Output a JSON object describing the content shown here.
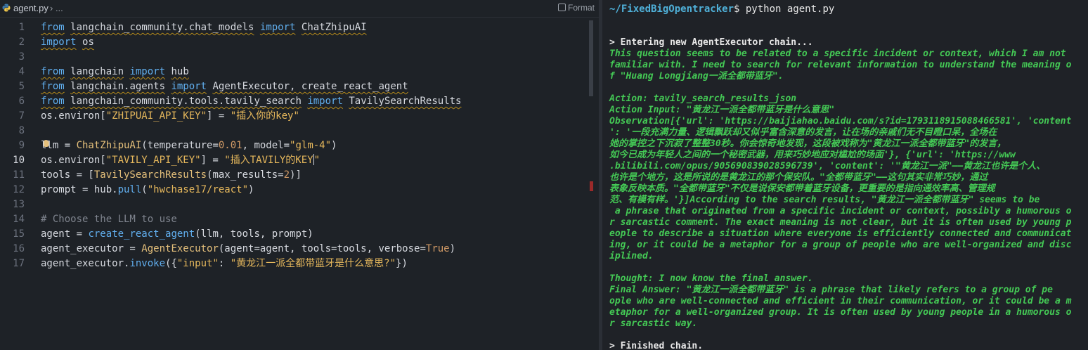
{
  "editor": {
    "tab_file": "agent.py",
    "tab_crumb": "› ...",
    "format_label": "Format",
    "line_numbers": [
      "1",
      "2",
      "3",
      "4",
      "5",
      "6",
      "7",
      "8",
      "9",
      "10",
      "11",
      "12",
      "13",
      "14",
      "15",
      "16",
      "17"
    ]
  },
  "code": {
    "l1": {
      "a": "from",
      "b": "langchain_community.chat_models",
      "c": "import",
      "d": "ChatZhipuAI"
    },
    "l2": {
      "a": "import",
      "b": "os"
    },
    "l4": {
      "a": "from",
      "b": "langchain",
      "c": "import",
      "d": "hub"
    },
    "l5": {
      "a": "from",
      "b": "langchain.agents",
      "c": "import",
      "d": "AgentExecutor, create_react_agent"
    },
    "l6": {
      "a": "from",
      "b": "langchain_community.tools.tavily_search",
      "c": "import",
      "d": "TavilySearchResults"
    },
    "l7": {
      "a": "os.environ[",
      "b": "\"ZHIPUAI_API_KEY\"",
      "c": "] = ",
      "d": "\"插入你的key\""
    },
    "l9": {
      "a": "llm = ",
      "b": "ChatZhipuAI",
      "c": "(temperature=",
      "d": "0.01",
      "e": ", model=",
      "f": "\"glm-4\"",
      "g": ")"
    },
    "l10": {
      "a": "os.environ[",
      "b": "\"TAVILY_API_KEY\"",
      "c": "] = ",
      "d": "\"插入TAVILY的KEY",
      "e": "\""
    },
    "l11": {
      "a": "tools = [",
      "b": "TavilySearchResults",
      "c": "(max_results=",
      "d": "2",
      "e": ")]"
    },
    "l12": {
      "a": "prompt = hub.",
      "b": "pull",
      "c": "(",
      "d": "\"hwchase17/react\"",
      "e": ")"
    },
    "l14": {
      "a": "# Choose the LLM to use"
    },
    "l15": {
      "a": "agent = ",
      "b": "create_react_agent",
      "c": "(llm, tools, prompt)"
    },
    "l16": {
      "a": "agent_executor = ",
      "b": "AgentExecutor",
      "c": "(agent=agent, tools=tools, verbose=",
      "d": "True",
      "e": ")"
    },
    "l17": {
      "a": "agent_executor.",
      "b": "invoke",
      "c": "({",
      "d": "\"input\"",
      "e": ": ",
      "f": "\"黄龙江一派全都带蓝牙是什么意思?\"",
      "g": "})"
    }
  },
  "terminal": {
    "prompt_path": "~/FixedBigOpentracker",
    "prompt_cmd": "$ python agent.py",
    "lines": [
      {
        "text": "> Entering new AgentExecutor chain...",
        "style": "white"
      },
      {
        "text": "This question seems to be related to a specific incident or context, which I am not",
        "style": "green"
      },
      {
        "text": "familiar with. I need to search for relevant information to understand the meaning o",
        "style": "green"
      },
      {
        "text": "f \"Huang Longjiang一派全都带蓝牙\".",
        "style": "green"
      },
      {
        "text": "",
        "style": "green"
      },
      {
        "text": "Action: tavily_search_results_json",
        "style": "green"
      },
      {
        "text": "Action Input: \"黄龙江一派全都带蓝牙是什么意思\"",
        "style": "green"
      },
      {
        "text": "Observation[{'url': 'https://baijiahao.baidu.com/s?id=1793118915088466581', 'content",
        "style": "green"
      },
      {
        "text": "': '一段充满力量、逻辑飘跃却又似乎富含深意的发言，让在场的亲戚们无不目瞪口呆，全场在",
        "style": "green"
      },
      {
        "text": "她的掌控之下沉寂了整整30秒。你会惊奇地发现，这段被戏称为\"黄龙江一派全都带蓝牙\"的发言，",
        "style": "green"
      },
      {
        "text": "如今已成为年轻人之间的一个秘密武器，用来巧妙地应对尴尬的场面'}, {'url': 'https://www",
        "style": "green"
      },
      {
        "text": ".bilibili.com/opus/905690839028596739', 'content': '\"黄龙江一派\"——黄龙江也许是个人、",
        "style": "green"
      },
      {
        "text": "也许是个地方，这是所说的是黄龙江的那个保安队。\"全都带蓝牙\"——这句其实非常巧妙，通过",
        "style": "green"
      },
      {
        "text": "表象反映本质。\"全都带蓝牙\"不仅是说保安都带着蓝牙设备，更重要的是指向通效率高、管理规",
        "style": "green"
      },
      {
        "text": "范、有模有样。'}]According to the search results, \"黄龙江一派全都带蓝牙\" seems to be",
        "style": "green"
      },
      {
        "text": " a phrase that originated from a specific incident or context, possibly a humorous o",
        "style": "green"
      },
      {
        "text": "r sarcastic comment. The exact meaning is not clear, but it is often used by young p",
        "style": "green"
      },
      {
        "text": "eople to describe a situation where everyone is efficiently connected and communicat",
        "style": "green"
      },
      {
        "text": "ing, or it could be a metaphor for a group of people who are well-organized and disc",
        "style": "green"
      },
      {
        "text": "iplined.",
        "style": "green"
      },
      {
        "text": "",
        "style": "green"
      },
      {
        "text": "Thought: I now know the final answer.",
        "style": "green"
      },
      {
        "text": "Final Answer: \"黄龙江一派全都带蓝牙\" is a phrase that likely refers to a group of pe",
        "style": "green"
      },
      {
        "text": "ople who are well-connected and efficient in their communication, or it could be a m",
        "style": "green"
      },
      {
        "text": "etaphor for a well-organized group. It is often used by young people in a humorous o",
        "style": "green"
      },
      {
        "text": "r sarcastic way.",
        "style": "green"
      },
      {
        "text": "",
        "style": "green"
      },
      {
        "text": "> Finished chain.",
        "style": "white"
      }
    ]
  }
}
